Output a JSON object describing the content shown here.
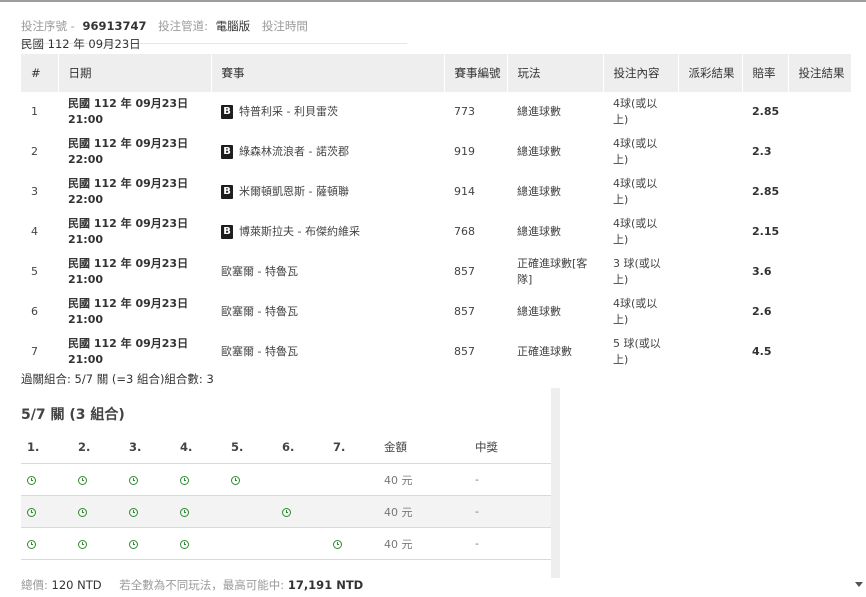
{
  "header": {
    "serial_label": "投注序號 -",
    "serial_value": "96913747",
    "channel_label": "投注管道:",
    "channel_value": "電腦版",
    "time_label": "投注時間",
    "time_value": "民國 112 年 09月23日"
  },
  "columns": [
    "#",
    "日期",
    "賽事",
    "賽事編號",
    "玩法",
    "投注內容",
    "派彩結果",
    "賠率",
    "投注結果"
  ],
  "rows": [
    {
      "no": "1",
      "date": "民國 112 年 09月23日",
      "time": "21:00",
      "badge": "B",
      "match": "特普利采 - 利貝雷茨",
      "id": "773",
      "play": "總進球數",
      "pick": "4球(或以上)",
      "result": "",
      "odds": "2.85",
      "outcome": ""
    },
    {
      "no": "2",
      "date": "民國 112 年 09月23日",
      "time": "22:00",
      "badge": "B",
      "match": "綠森林流浪者 - 諾茨郡",
      "id": "919",
      "play": "總進球數",
      "pick": "4球(或以上)",
      "result": "",
      "odds": "2.3",
      "outcome": ""
    },
    {
      "no": "3",
      "date": "民國 112 年 09月23日",
      "time": "22:00",
      "badge": "B",
      "match": "米爾頓凱恩斯 - 薩頓聯",
      "id": "914",
      "play": "總進球數",
      "pick": "4球(或以上)",
      "result": "",
      "odds": "2.85",
      "outcome": ""
    },
    {
      "no": "4",
      "date": "民國 112 年 09月23日",
      "time": "21:00",
      "badge": "B",
      "match": "博萊斯拉夫 - 布傑約維采",
      "id": "768",
      "play": "總進球數",
      "pick": "4球(或以上)",
      "result": "",
      "odds": "2.15",
      "outcome": ""
    },
    {
      "no": "5",
      "date": "民國 112 年 09月23日",
      "time": "21:00",
      "badge": "",
      "match": "歐塞爾 - 特魯瓦",
      "id": "857",
      "play": "正確進球數[客隊]",
      "pick": "3 球(或以上)",
      "result": "",
      "odds": "3.6",
      "outcome": ""
    },
    {
      "no": "6",
      "date": "民國 112 年 09月23日",
      "time": "21:00",
      "badge": "",
      "match": "歐塞爾 - 特魯瓦",
      "id": "857",
      "play": "總進球數",
      "pick": "4球(或以上)",
      "result": "",
      "odds": "2.6",
      "outcome": ""
    },
    {
      "no": "7",
      "date": "民國 112 年 09月23日",
      "time": "21:00",
      "badge": "",
      "match": "歐塞爾 - 特魯瓦",
      "id": "857",
      "play": "正確進球數",
      "pick": "5 球(或以上)",
      "result": "",
      "odds": "4.5",
      "outcome": ""
    }
  ],
  "parlay_note": "過關組合: 5/7 關 (=3 組合)組合數: 3",
  "combo": {
    "title": "5/7 關 (3 組合)",
    "headers": [
      "1.",
      "2.",
      "3.",
      "4.",
      "5.",
      "6.",
      "7.",
      "金額",
      "中獎"
    ],
    "rows": [
      {
        "picks": [
          true,
          true,
          true,
          true,
          true,
          false,
          false
        ],
        "amount": "40 元",
        "win": "-"
      },
      {
        "picks": [
          true,
          true,
          true,
          true,
          false,
          true,
          false
        ],
        "amount": "40 元",
        "win": "-"
      },
      {
        "picks": [
          true,
          true,
          true,
          true,
          false,
          false,
          true
        ],
        "amount": "40 元",
        "win": "-"
      }
    ]
  },
  "footer": {
    "total_label": "總價:",
    "total_value": "120 NTD",
    "max_label": "若全數為不同玩法，最高可能中:",
    "max_value": "17,191 NTD"
  }
}
